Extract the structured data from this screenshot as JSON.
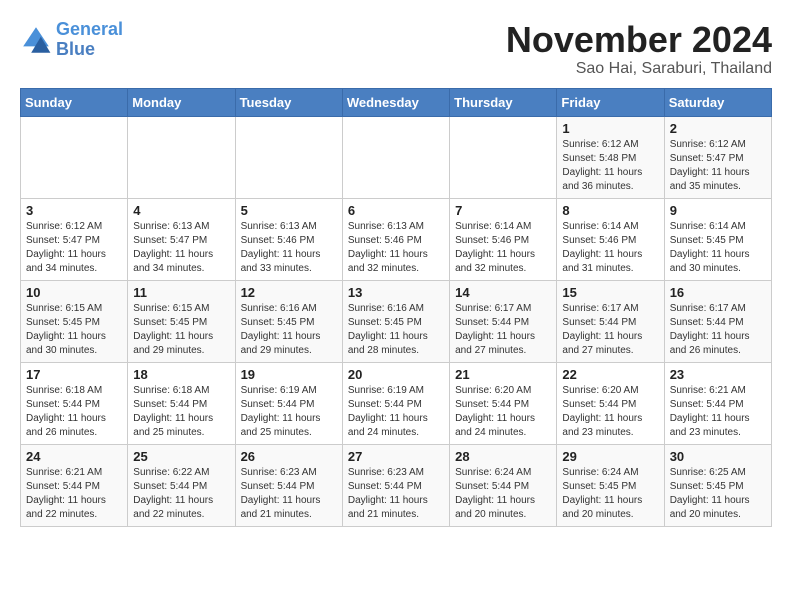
{
  "header": {
    "logo_line1": "General",
    "logo_line2": "Blue",
    "month": "November 2024",
    "location": "Sao Hai, Saraburi, Thailand"
  },
  "weekdays": [
    "Sunday",
    "Monday",
    "Tuesday",
    "Wednesday",
    "Thursday",
    "Friday",
    "Saturday"
  ],
  "weeks": [
    [
      {
        "day": "",
        "info": ""
      },
      {
        "day": "",
        "info": ""
      },
      {
        "day": "",
        "info": ""
      },
      {
        "day": "",
        "info": ""
      },
      {
        "day": "",
        "info": ""
      },
      {
        "day": "1",
        "info": "Sunrise: 6:12 AM\nSunset: 5:48 PM\nDaylight: 11 hours\nand 36 minutes."
      },
      {
        "day": "2",
        "info": "Sunrise: 6:12 AM\nSunset: 5:47 PM\nDaylight: 11 hours\nand 35 minutes."
      }
    ],
    [
      {
        "day": "3",
        "info": "Sunrise: 6:12 AM\nSunset: 5:47 PM\nDaylight: 11 hours\nand 34 minutes."
      },
      {
        "day": "4",
        "info": "Sunrise: 6:13 AM\nSunset: 5:47 PM\nDaylight: 11 hours\nand 34 minutes."
      },
      {
        "day": "5",
        "info": "Sunrise: 6:13 AM\nSunset: 5:46 PM\nDaylight: 11 hours\nand 33 minutes."
      },
      {
        "day": "6",
        "info": "Sunrise: 6:13 AM\nSunset: 5:46 PM\nDaylight: 11 hours\nand 32 minutes."
      },
      {
        "day": "7",
        "info": "Sunrise: 6:14 AM\nSunset: 5:46 PM\nDaylight: 11 hours\nand 32 minutes."
      },
      {
        "day": "8",
        "info": "Sunrise: 6:14 AM\nSunset: 5:46 PM\nDaylight: 11 hours\nand 31 minutes."
      },
      {
        "day": "9",
        "info": "Sunrise: 6:14 AM\nSunset: 5:45 PM\nDaylight: 11 hours\nand 30 minutes."
      }
    ],
    [
      {
        "day": "10",
        "info": "Sunrise: 6:15 AM\nSunset: 5:45 PM\nDaylight: 11 hours\nand 30 minutes."
      },
      {
        "day": "11",
        "info": "Sunrise: 6:15 AM\nSunset: 5:45 PM\nDaylight: 11 hours\nand 29 minutes."
      },
      {
        "day": "12",
        "info": "Sunrise: 6:16 AM\nSunset: 5:45 PM\nDaylight: 11 hours\nand 29 minutes."
      },
      {
        "day": "13",
        "info": "Sunrise: 6:16 AM\nSunset: 5:45 PM\nDaylight: 11 hours\nand 28 minutes."
      },
      {
        "day": "14",
        "info": "Sunrise: 6:17 AM\nSunset: 5:44 PM\nDaylight: 11 hours\nand 27 minutes."
      },
      {
        "day": "15",
        "info": "Sunrise: 6:17 AM\nSunset: 5:44 PM\nDaylight: 11 hours\nand 27 minutes."
      },
      {
        "day": "16",
        "info": "Sunrise: 6:17 AM\nSunset: 5:44 PM\nDaylight: 11 hours\nand 26 minutes."
      }
    ],
    [
      {
        "day": "17",
        "info": "Sunrise: 6:18 AM\nSunset: 5:44 PM\nDaylight: 11 hours\nand 26 minutes."
      },
      {
        "day": "18",
        "info": "Sunrise: 6:18 AM\nSunset: 5:44 PM\nDaylight: 11 hours\nand 25 minutes."
      },
      {
        "day": "19",
        "info": "Sunrise: 6:19 AM\nSunset: 5:44 PM\nDaylight: 11 hours\nand 25 minutes."
      },
      {
        "day": "20",
        "info": "Sunrise: 6:19 AM\nSunset: 5:44 PM\nDaylight: 11 hours\nand 24 minutes."
      },
      {
        "day": "21",
        "info": "Sunrise: 6:20 AM\nSunset: 5:44 PM\nDaylight: 11 hours\nand 24 minutes."
      },
      {
        "day": "22",
        "info": "Sunrise: 6:20 AM\nSunset: 5:44 PM\nDaylight: 11 hours\nand 23 minutes."
      },
      {
        "day": "23",
        "info": "Sunrise: 6:21 AM\nSunset: 5:44 PM\nDaylight: 11 hours\nand 23 minutes."
      }
    ],
    [
      {
        "day": "24",
        "info": "Sunrise: 6:21 AM\nSunset: 5:44 PM\nDaylight: 11 hours\nand 22 minutes."
      },
      {
        "day": "25",
        "info": "Sunrise: 6:22 AM\nSunset: 5:44 PM\nDaylight: 11 hours\nand 22 minutes."
      },
      {
        "day": "26",
        "info": "Sunrise: 6:23 AM\nSunset: 5:44 PM\nDaylight: 11 hours\nand 21 minutes."
      },
      {
        "day": "27",
        "info": "Sunrise: 6:23 AM\nSunset: 5:44 PM\nDaylight: 11 hours\nand 21 minutes."
      },
      {
        "day": "28",
        "info": "Sunrise: 6:24 AM\nSunset: 5:44 PM\nDaylight: 11 hours\nand 20 minutes."
      },
      {
        "day": "29",
        "info": "Sunrise: 6:24 AM\nSunset: 5:45 PM\nDaylight: 11 hours\nand 20 minutes."
      },
      {
        "day": "30",
        "info": "Sunrise: 6:25 AM\nSunset: 5:45 PM\nDaylight: 11 hours\nand 20 minutes."
      }
    ]
  ]
}
